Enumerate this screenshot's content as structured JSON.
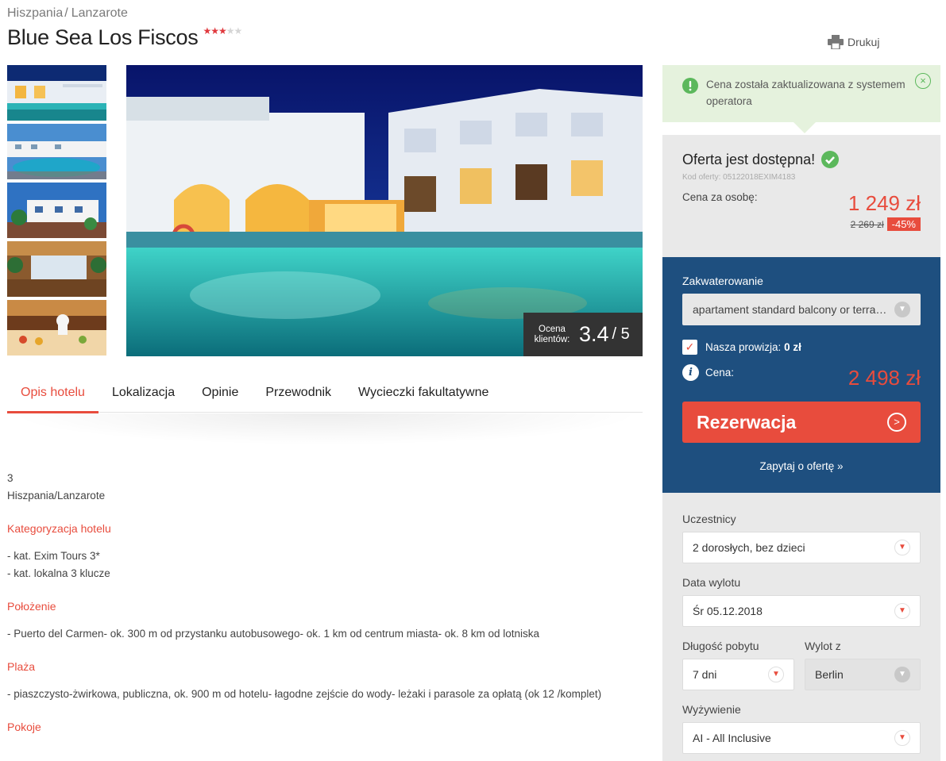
{
  "breadcrumb": {
    "country": "Hiszpania",
    "region": "Lanzarote",
    "separator": "/"
  },
  "hotel": {
    "name": "Blue Sea Los Fiscos",
    "stars": 3,
    "max_stars": 5
  },
  "print_label": "Drukuj",
  "rating": {
    "label_line1": "Ocena",
    "label_line2": "klientów:",
    "value": "3.4",
    "max": "/ 5"
  },
  "tabs": [
    {
      "label": "Opis hotelu",
      "active": true
    },
    {
      "label": "Lokalizacja"
    },
    {
      "label": "Opinie"
    },
    {
      "label": "Przewodnik"
    },
    {
      "label": "Wycieczki fakultatywne"
    }
  ],
  "description": {
    "stars_line": "3",
    "location_line": "Hiszpania/Lanzarote",
    "sections": [
      {
        "heading": "Kategoryzacja hotelu",
        "lines": [
          "- kat. Exim Tours 3*",
          "- kat. lokalna 3 klucze"
        ]
      },
      {
        "heading": "Położenie",
        "lines": [
          "- Puerto del Carmen- ok. 300 m od przystanku autobusowego- ok. 1 km od centrum miasta- ok. 8 km od lotniska"
        ]
      },
      {
        "heading": "Plaża",
        "lines": [
          "- piaszczysto-żwirkowa, publiczna, ok. 900 m od hotelu- łagodne zejście do wody- leżaki i parasole za opłatą (ok 12 /komplet)"
        ]
      },
      {
        "heading": "Pokoje",
        "lines": []
      }
    ]
  },
  "notice": {
    "text": "Cena została zaktualizowana z systemem operatora",
    "close": "×"
  },
  "offer": {
    "title": "Oferta jest dostępna!",
    "code_label": "Kod oferty:",
    "code": "05122018EXIM4183",
    "price_label": "Cena za osobę:",
    "price": "1 249 zł",
    "old_price": "2 269 zł",
    "discount": "-45%"
  },
  "booking": {
    "accommodation_label": "Zakwaterowanie",
    "accommodation_value": "apartament standard balcony or terra…",
    "commission_label": "Nasza prowizja:",
    "commission_value": "0 zł",
    "total_label": "Cena:",
    "total_value": "2 498 zł",
    "reserve_label": "Rezerwacja",
    "ask_label": "Zapytaj o ofertę »"
  },
  "filters": {
    "participants_label": "Uczestnicy",
    "participants_value": "2 dorosłych, bez dzieci",
    "date_label": "Data wylotu",
    "date_value": "Śr 05.12.2018",
    "duration_label": "Długość pobytu",
    "duration_value": "7 dni",
    "departure_label": "Wylot z",
    "departure_value": "Berlin",
    "board_label": "Wyżywienie",
    "board_value": "AI - All Inclusive"
  },
  "colors": {
    "accent": "#e84c3d",
    "booking_bg": "#1e4f7f",
    "notice_bg": "#e5f2dd",
    "ok_green": "#5cb85c"
  }
}
